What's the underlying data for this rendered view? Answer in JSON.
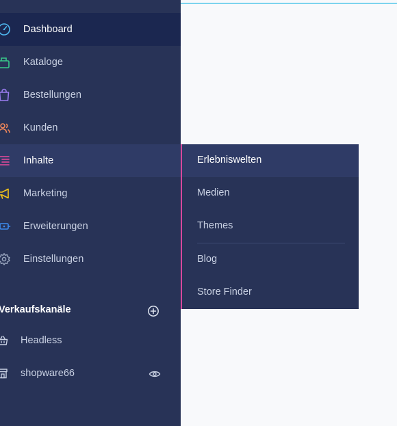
{
  "nav": {
    "items": [
      {
        "label": "Dashboard",
        "icon": "dashboard-gauge-icon",
        "color": "#4fb8f0"
      },
      {
        "label": "Kataloge",
        "icon": "catalog-icon",
        "color": "#38c98a"
      },
      {
        "label": "Bestellungen",
        "icon": "orders-bag-icon",
        "color": "#9a7cf0"
      },
      {
        "label": "Kunden",
        "icon": "customers-icon",
        "color": "#f0875a"
      },
      {
        "label": "Inhalte",
        "icon": "content-icon",
        "color": "#e94b9c"
      },
      {
        "label": "Marketing",
        "icon": "marketing-megaphone-icon",
        "color": "#f5c518"
      },
      {
        "label": "Erweiterungen",
        "icon": "extensions-plug-icon",
        "color": "#3d8df0"
      },
      {
        "label": "Einstellungen",
        "icon": "settings-gear-icon",
        "color": "#9aa6bf"
      }
    ]
  },
  "sales_channels": {
    "title": "Verkaufskanäle",
    "add_icon": "add-circle-icon",
    "items": [
      {
        "label": "Headless",
        "icon": "basket-icon"
      },
      {
        "label": "shopware66",
        "icon": "storefront-icon",
        "action_icon": "eye-icon"
      }
    ]
  },
  "flyout": {
    "accent": "#d6489c",
    "items": [
      {
        "label": "Erlebniswelten"
      },
      {
        "label": "Medien"
      },
      {
        "label": "Themes"
      },
      {
        "label": "Blog"
      },
      {
        "label": "Store Finder"
      }
    ]
  },
  "colors": {
    "sidebar_bg": "#283357",
    "active_bg": "#1b2750",
    "hover_bg": "#2f3b66",
    "content_bg": "#f8f9fb",
    "top_accent": "#7dd3ee"
  }
}
